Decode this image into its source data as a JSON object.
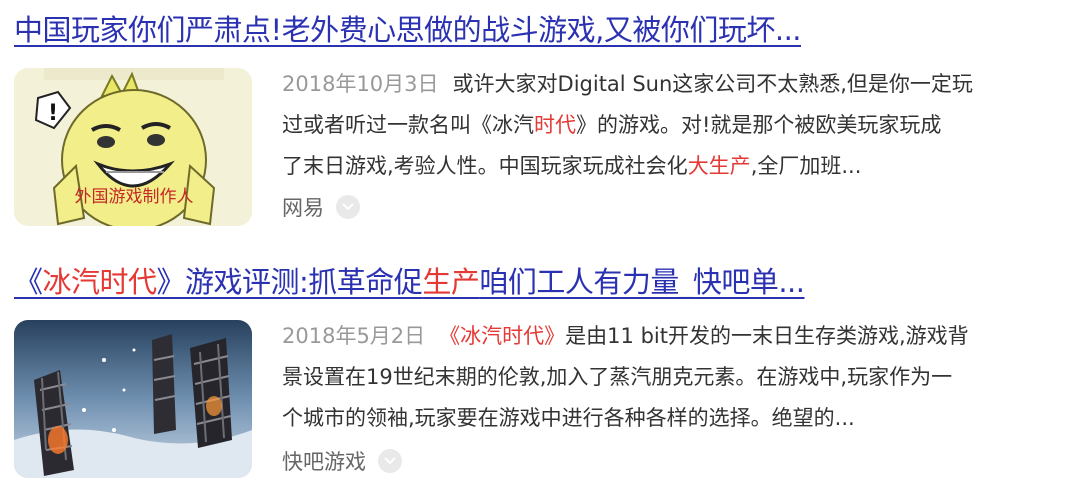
{
  "results": [
    {
      "title_pre": "中国玩家你们严肃点!老外费心思做的战斗游戏,又被你们玩坏...",
      "date": "2018年10月3日",
      "snippet_lines": [
        {
          "pre": "或许大家对Digital Sun这家公司不太熟悉,但是你一定玩",
          "hl": "",
          "post": ""
        },
        {
          "pre": "过或者听过一款名叫《冰汽",
          "hl": "时代",
          "post": "》的游戏。对!就是那个被欧美玩家玩成"
        },
        {
          "pre": "了末日游戏,考验人性。中国玩家玩成社会化",
          "hl": "大生产",
          "post": ",全厂加班..."
        }
      ],
      "thumb_caption": "外国游戏制作人",
      "source": "网易",
      "more_icon": "chevron-down-icon"
    },
    {
      "title_pre": "《",
      "title_hl1": "冰汽时代",
      "title_mid": "》游戏评测:抓革命促",
      "title_hl2": "生产",
      "title_post": "咱们工人有力量_快吧单...",
      "date": "2018年5月2日",
      "snippet_lines": [
        {
          "pre": "",
          "hl": "《冰汽时代》",
          "post": "是由11 bit开发的一末日生存类游戏,游戏背"
        },
        {
          "pre": "景设置在19世纪末期的伦敦,加入了蒸汽朋克元素。在游戏中,玩家作为一",
          "hl": "",
          "post": ""
        },
        {
          "pre": "个城市的领袖,玩家要在游戏中进行各种各样的选择。绝望的...",
          "hl": "",
          "post": ""
        }
      ],
      "source": "快吧游戏",
      "more_icon": "chevron-down-icon"
    }
  ],
  "colors": {
    "title": "#2b32b2",
    "highlight": "#e53935",
    "date": "#999999",
    "text": "#333333",
    "source": "#666666"
  }
}
